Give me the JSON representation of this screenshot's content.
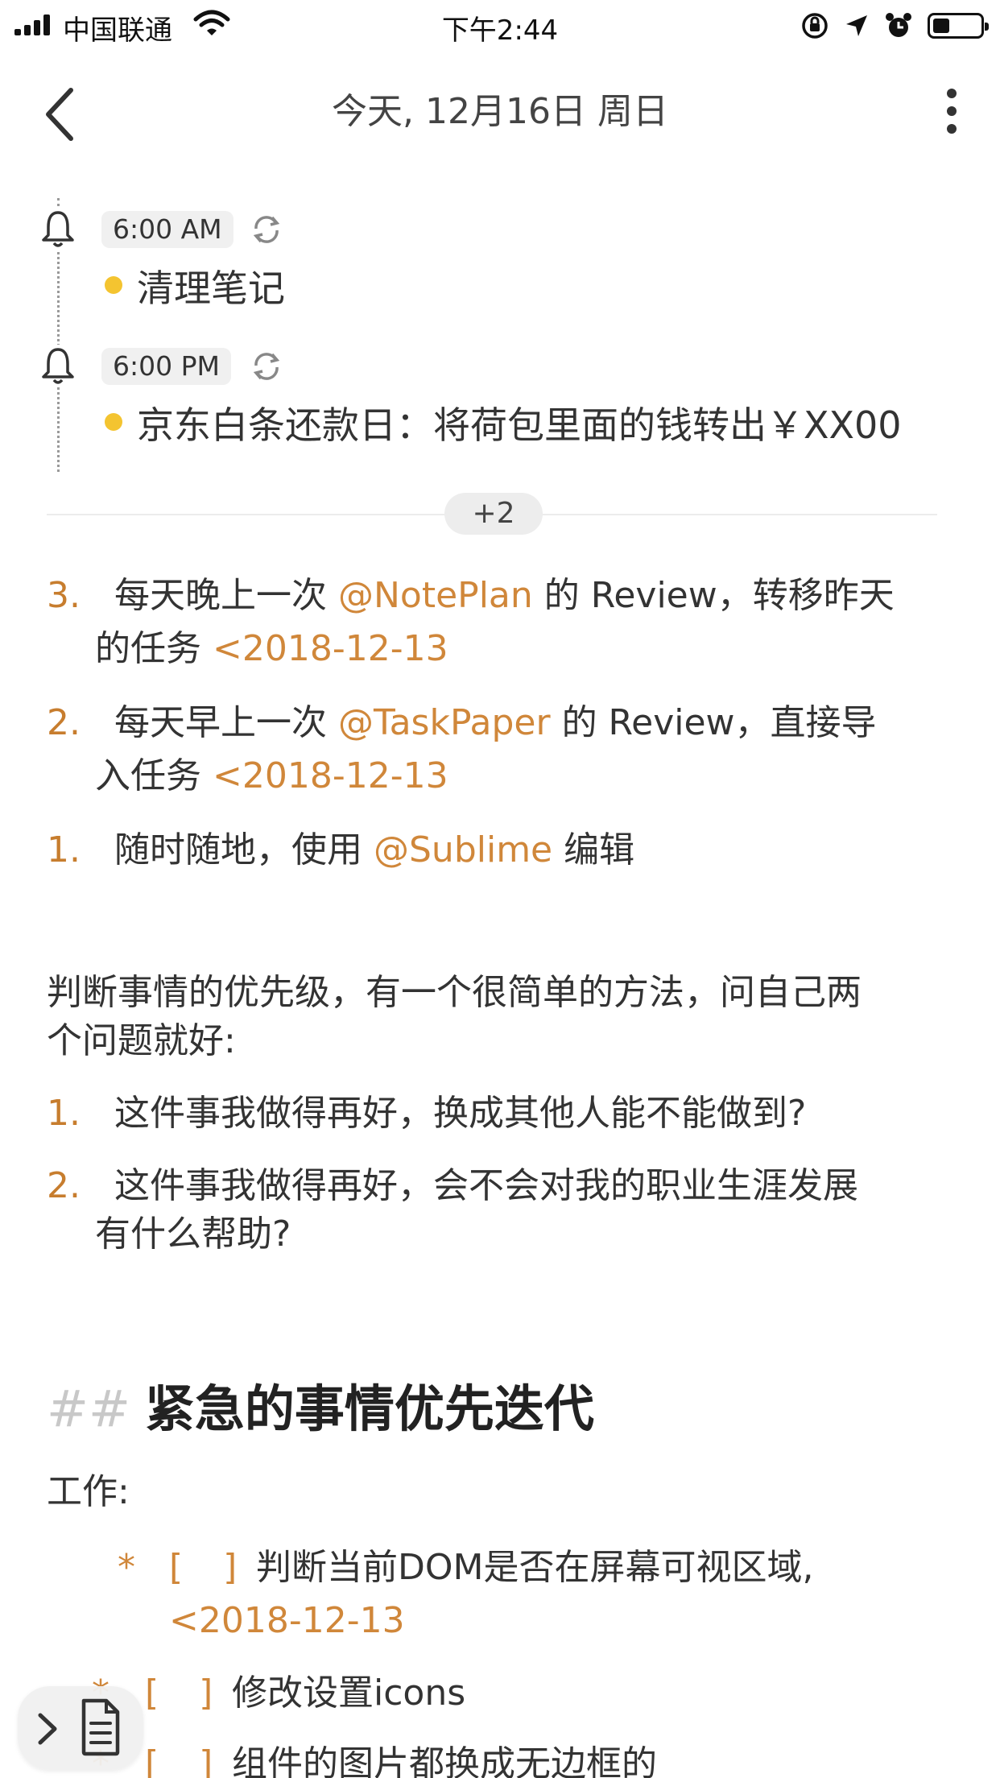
{
  "status_bar": {
    "carrier": "中国联通",
    "time": "下午2:44",
    "battery_level": 0.35
  },
  "header": {
    "title": "今天, 12月16日 周日"
  },
  "reminders": [
    {
      "time": "6:00 AM",
      "text": "清理笔记"
    },
    {
      "time": "6:00 PM",
      "text": "京东白条还款日：将荷包里面的钱转出￥XX00"
    }
  ],
  "more_pill": "+2",
  "list1": [
    {
      "num": "3.",
      "before": "每天晚上一次 ",
      "tag": "@NotePlan",
      "after": " 的 Review，转移昨天",
      "line2_before": "的任务 ",
      "date": "<2018-12-13"
    },
    {
      "num": "2.",
      "before": "每天早上一次 ",
      "tag": "@TaskPaper",
      "after": " 的 Review，直接导",
      "line2_before": "入任务 ",
      "date": "<2018-12-13"
    },
    {
      "num": "1.",
      "before": "随时随地，使用 ",
      "tag": "@Sublime",
      "after": " 编辑"
    }
  ],
  "paragraph": {
    "line1": "判断事情的优先级，有一个很简单的方法，问自己两",
    "line2": "个问题就好:"
  },
  "list2": [
    {
      "num": "1.",
      "line1": "这件事我做得再好，换成其他人能不能做到?"
    },
    {
      "num": "2.",
      "line1": "这件事我做得再好，会不会对我的职业生涯发展",
      "line2": "有什么帮助?"
    }
  ],
  "heading": {
    "hash": "##",
    "text": "紧急的事情优先迭代"
  },
  "work_label": "工作:",
  "todos": [
    {
      "star": "*",
      "box": "[ ]",
      "text": "判断当前DOM是否在屏幕可视区域,",
      "date": "<2018-12-13"
    },
    {
      "star": "*",
      "box": "[ ]",
      "text": "修改设置icons"
    },
    {
      "star": "*",
      "box": "[ ]",
      "text": "组件的图片都换成无边框的"
    }
  ],
  "colors": {
    "accent": "#d0873a",
    "number": "#c77d2e",
    "dot": "#f4c430",
    "text": "#333333"
  }
}
